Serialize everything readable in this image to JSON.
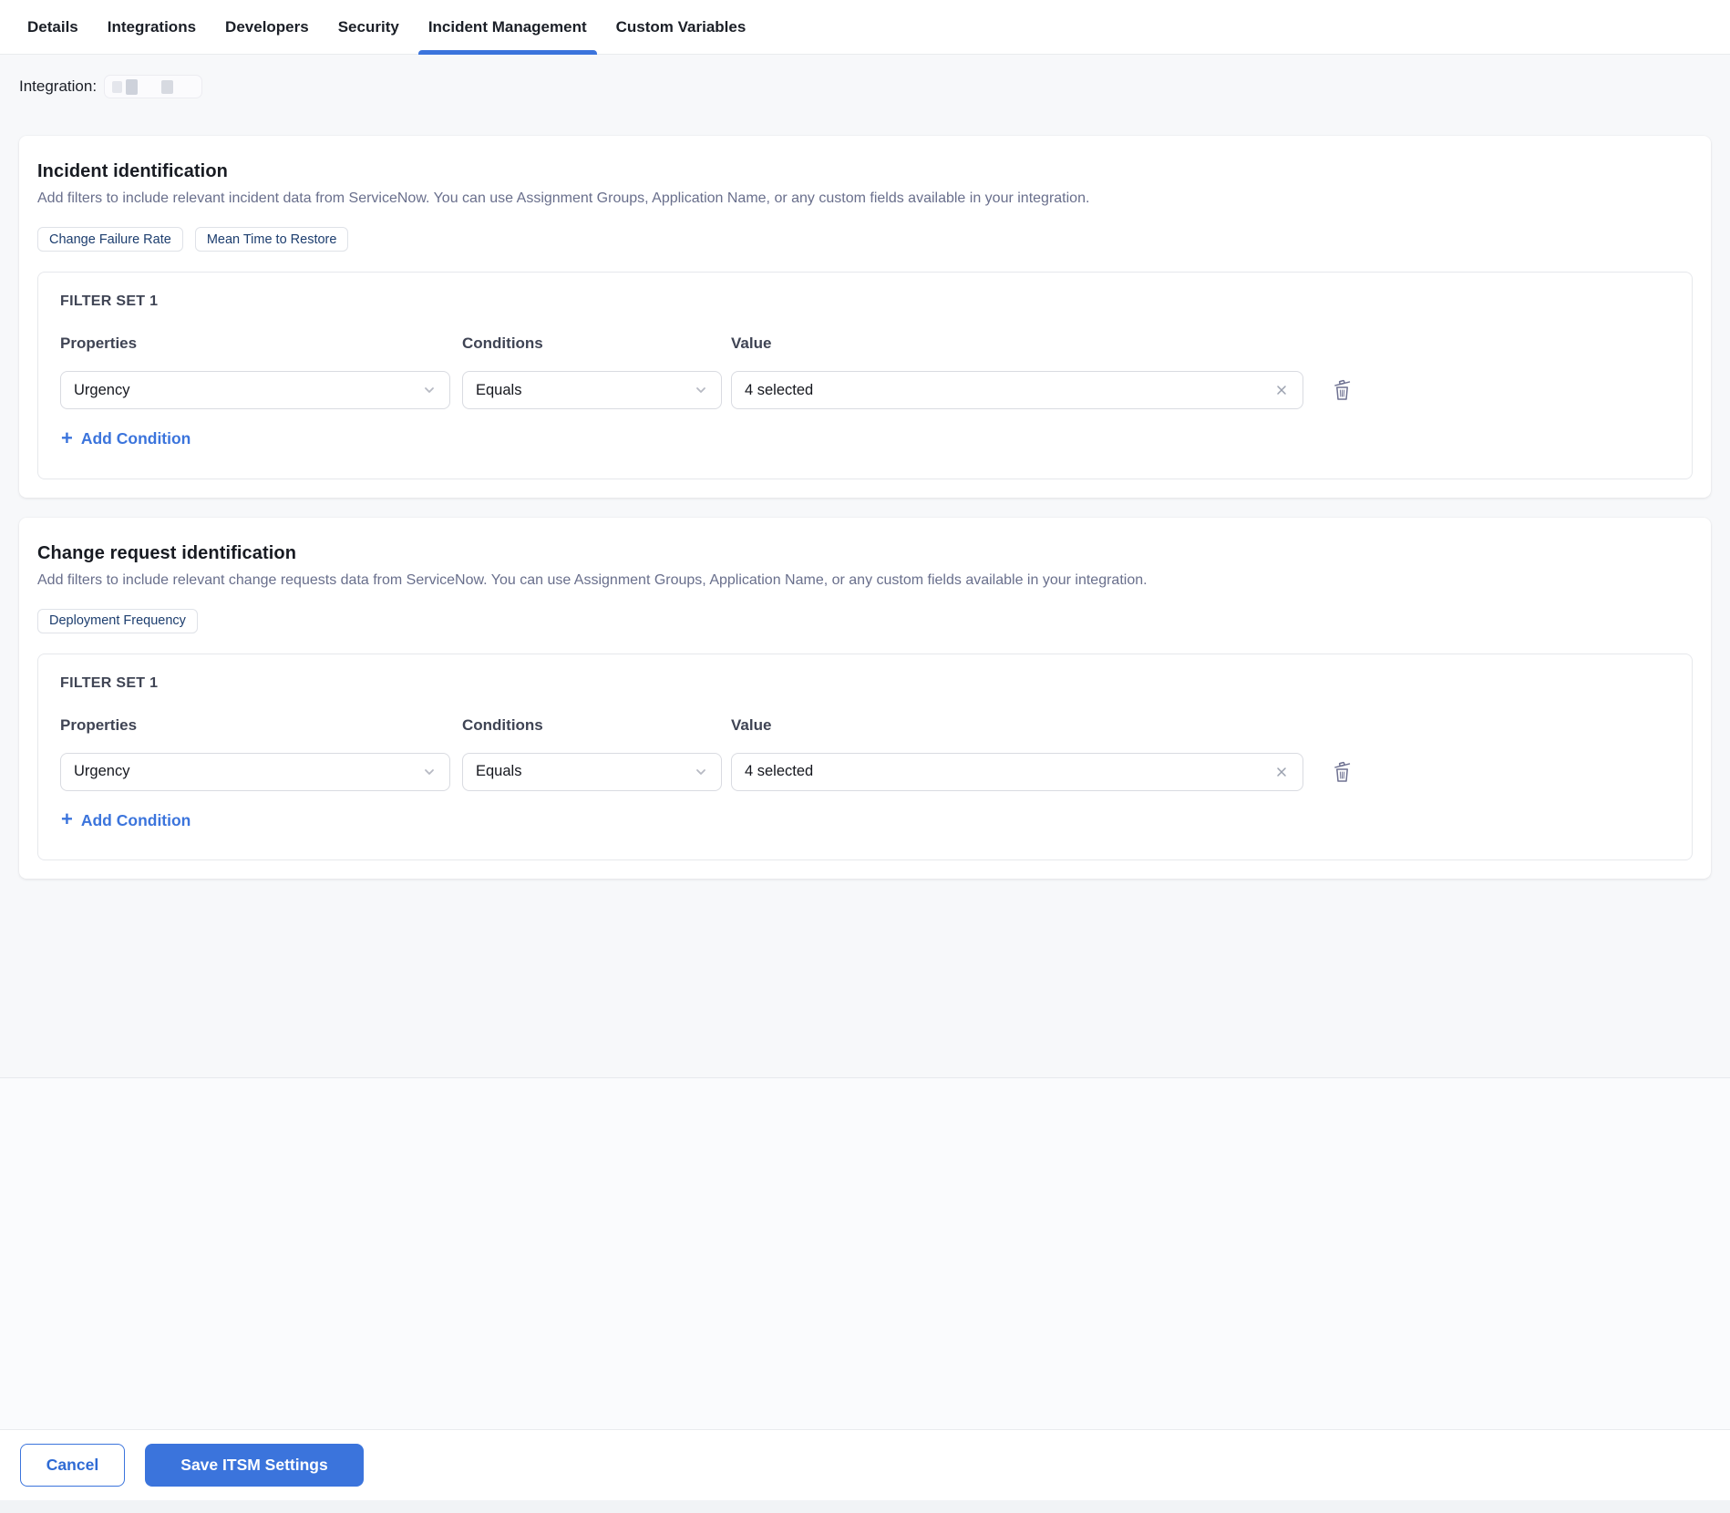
{
  "tabs": {
    "items": [
      "Details",
      "Integrations",
      "Developers",
      "Security",
      "Incident Management",
      "Custom Variables"
    ],
    "active": "Incident Management"
  },
  "integration_label": "Integration:",
  "sections": [
    {
      "title": "Incident identification",
      "description": "Add filters to include relevant incident data from ServiceNow. You can use Assignment Groups, Application Name, or any custom fields available in your integration.",
      "chips": [
        "Change Failure Rate",
        "Mean Time to Restore"
      ],
      "filter_set": {
        "title": "FILTER SET 1",
        "col_properties": "Properties",
        "col_conditions": "Conditions",
        "col_value": "Value",
        "property": "Urgency",
        "condition": "Equals",
        "value": "4 selected",
        "add_condition": "Add Condition"
      }
    },
    {
      "title": "Change request identification",
      "description": "Add filters to include relevant change requests data from ServiceNow. You can use Assignment Groups, Application Name, or any custom fields available in your integration.",
      "chips": [
        "Deployment Frequency"
      ],
      "filter_set": {
        "title": "FILTER SET 1",
        "col_properties": "Properties",
        "col_conditions": "Conditions",
        "col_value": "Value",
        "property": "Urgency",
        "condition": "Equals",
        "value": "4 selected",
        "add_condition": "Add Condition"
      }
    }
  ],
  "footer": {
    "cancel": "Cancel",
    "save": "Save ITSM Settings"
  },
  "colors": {
    "accent": "#3B74DC",
    "chip_text": "#1C3D6E",
    "heading": "#181B22",
    "description": "#696F8C",
    "field_border": "#D9DBE1",
    "muted_icon": "#9AA0AE",
    "trash_icon": "#6E7191"
  }
}
